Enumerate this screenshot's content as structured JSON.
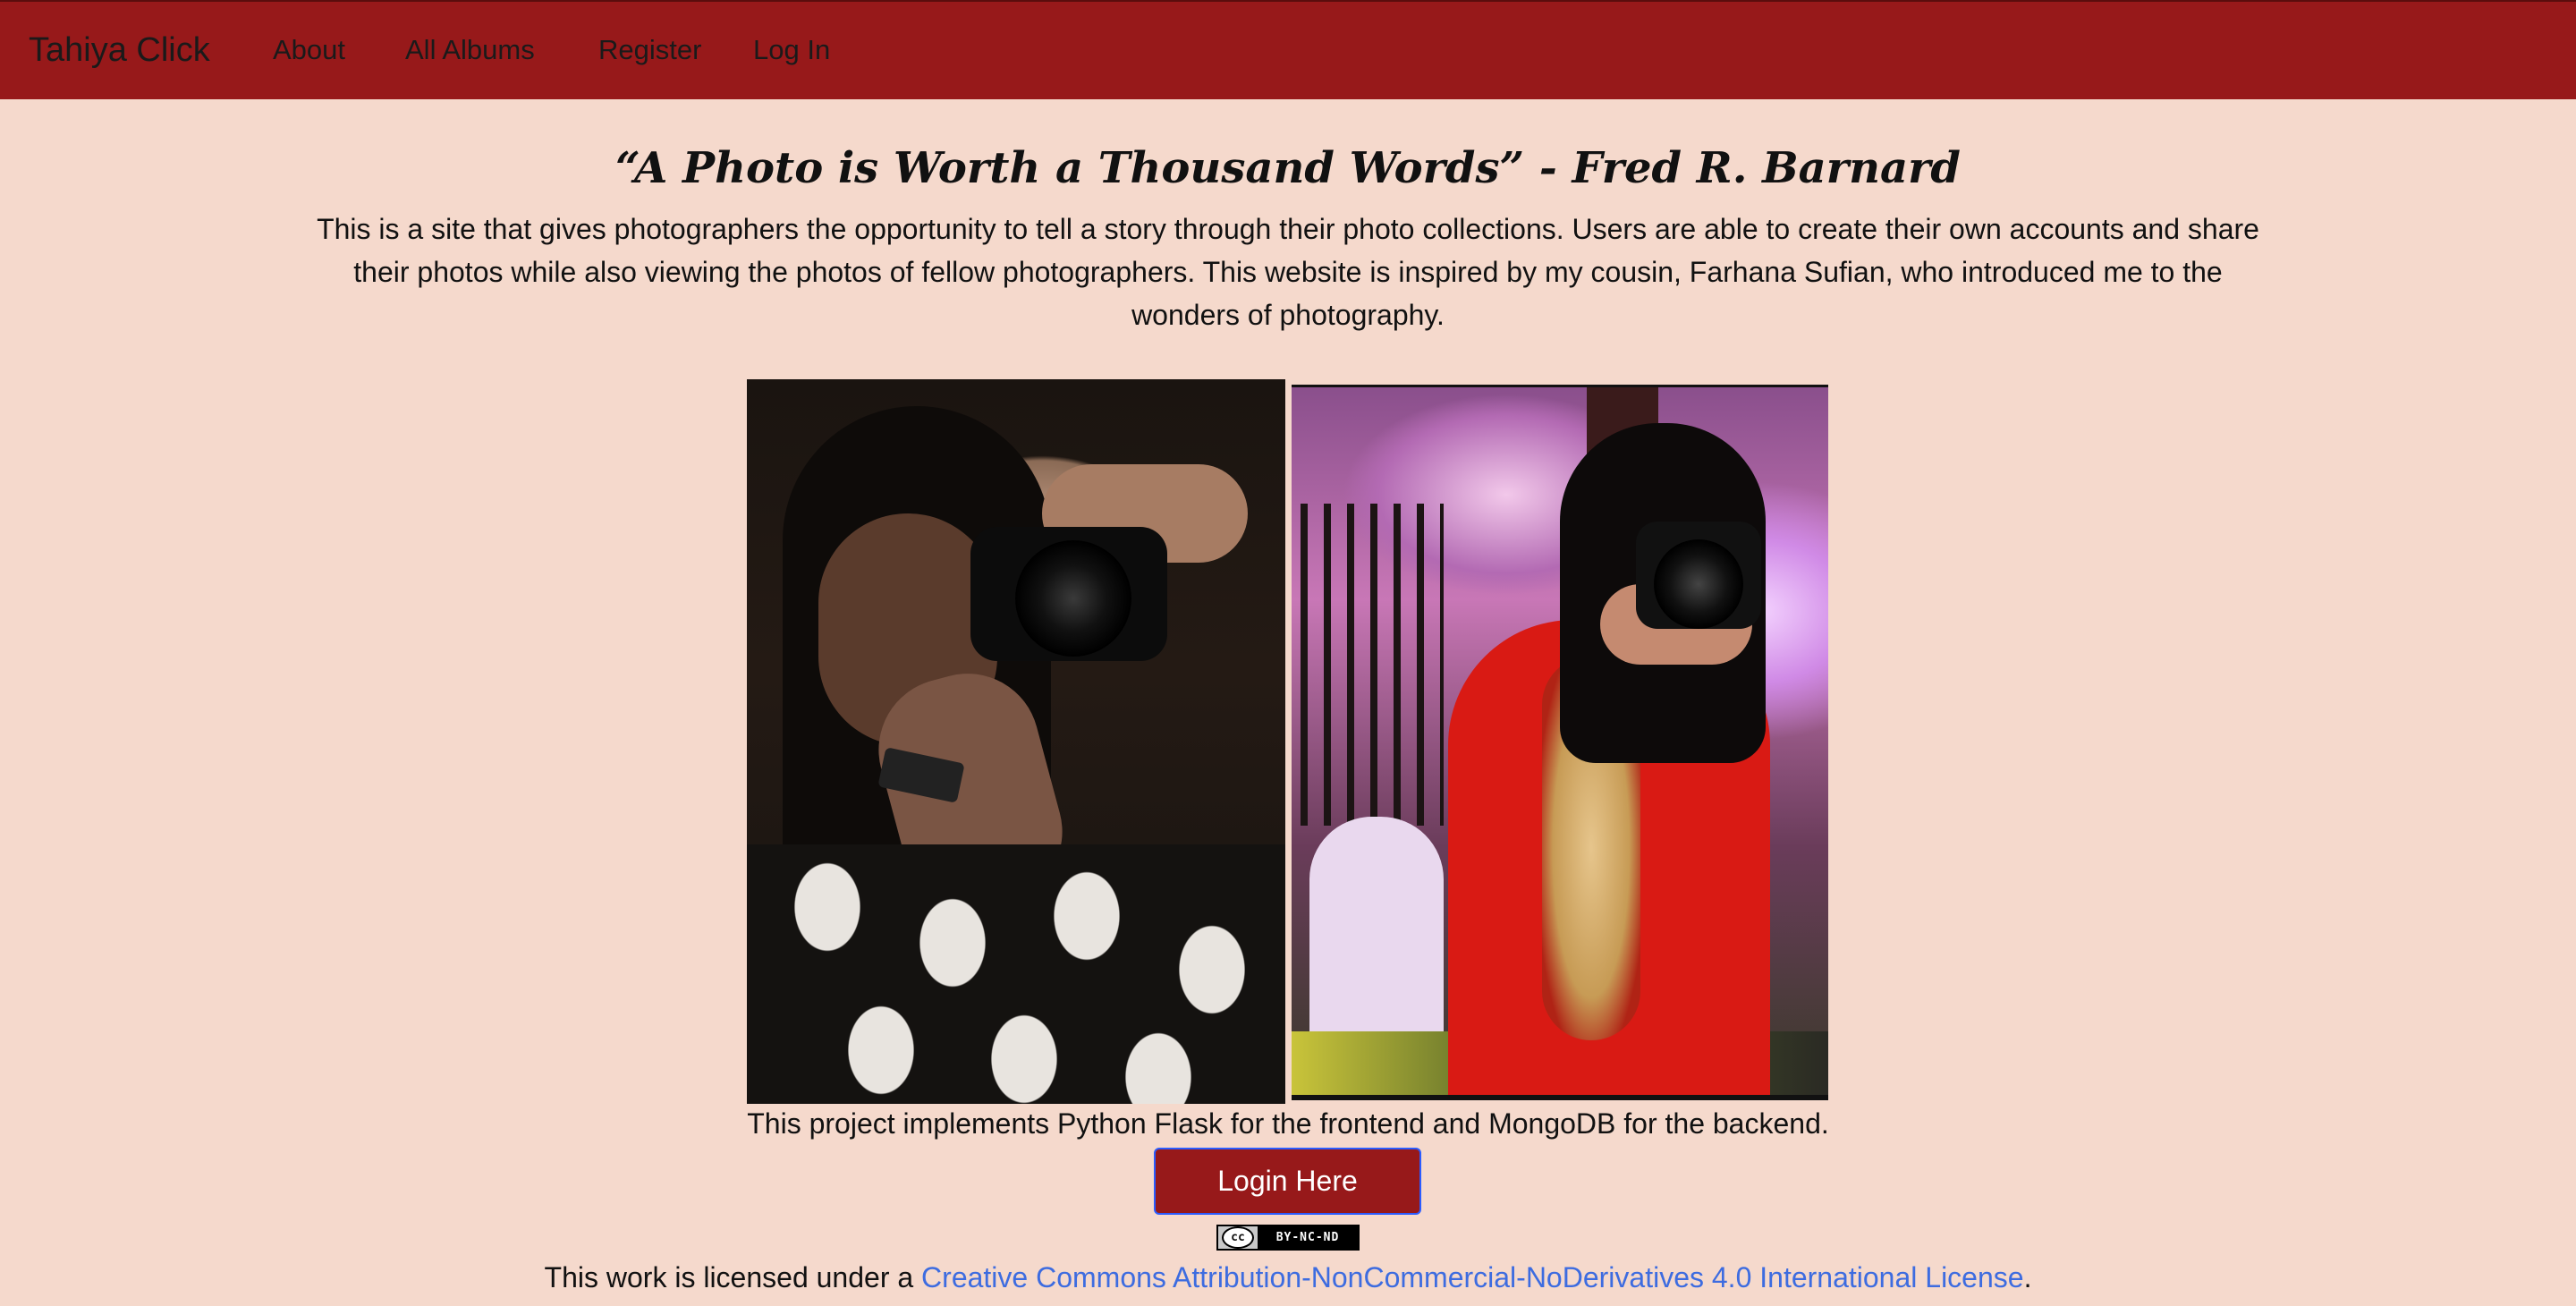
{
  "navbar": {
    "brand": "Tahiya Click",
    "links": [
      {
        "label": "About"
      },
      {
        "label": "All Albums"
      },
      {
        "label": "Register"
      },
      {
        "label": "Log In"
      }
    ]
  },
  "hero": {
    "quote": "“A Photo is Worth a Thousand Words” - Fred R. Barnard",
    "intro": "This is a site that gives photographers the opportunity to tell a story through their photo collections. Users are able to create their own accounts and share their photos while also viewing the photos of fellow photographers. This website is inspired by my cousin, Farhana Sufian, who introduced me to the wonders of photography."
  },
  "footer": {
    "caption": "This project implements Python Flask for the frontend and MongoDB for the backend.",
    "login_button": "Login Here",
    "cc_icon": "cc",
    "cc_badge": "BY-NC-ND",
    "license_prefix": "This work is licensed under a ",
    "license_link": "Creative Commons Attribution-NonCommercial-NoDerivatives 4.0 International License",
    "license_suffix": "."
  },
  "colors": {
    "navbar_bg": "#97191a",
    "page_bg": "#f5d9cc",
    "link": "#3d6ce0"
  }
}
